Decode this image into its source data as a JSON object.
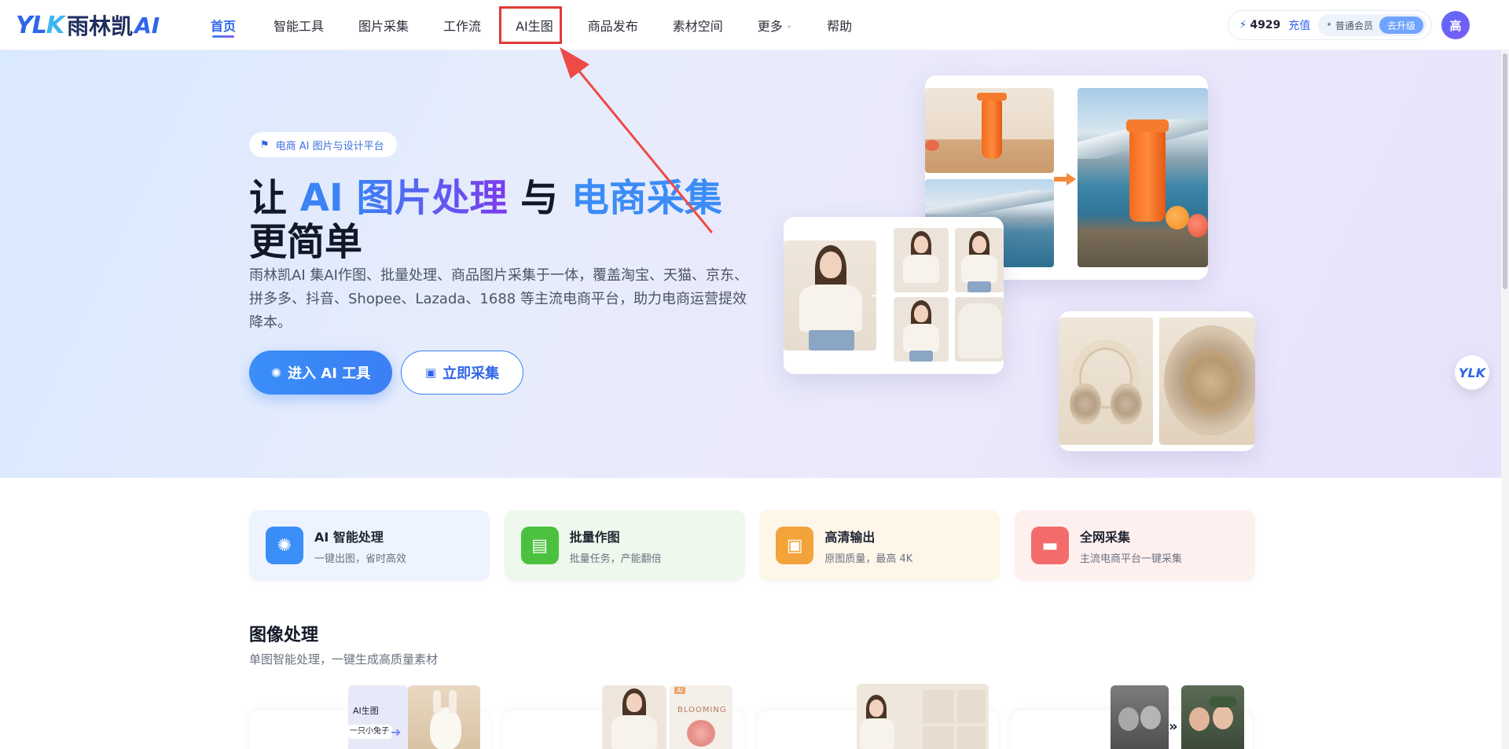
{
  "nav": {
    "logo_latin": "YLK",
    "logo_cn": "雨林凯",
    "logo_ai": "AI",
    "items": [
      {
        "label": "首页",
        "active": true
      },
      {
        "label": "智能工具"
      },
      {
        "label": "图片采集"
      },
      {
        "label": "工作流"
      },
      {
        "label": "AI生图",
        "highlighted": true
      },
      {
        "label": "商品发布"
      },
      {
        "label": "素材空间"
      },
      {
        "label": "更多",
        "has_dropdown": true
      },
      {
        "label": "帮助"
      }
    ],
    "credits": "4929",
    "recharge": "充值",
    "member": "普通会员",
    "upgrade": "去升级",
    "avatar": "高",
    "colors": {
      "accent": "#2f66e8",
      "highlight": "#e53935"
    }
  },
  "hero": {
    "badge": "电商 AI 图片与设计平台",
    "headline": {
      "p1": "让 ",
      "p2": "AI",
      "p3": " ",
      "p4": "图片处理",
      "p5": " 与 ",
      "p6": "电商采集",
      "p7": "更简单"
    },
    "description": "雨林凯AI 集AI作图、批量处理、商品图片采集于一体，覆盖淘宝、天猫、京东、拼多多、抖音、Shopee、Lazada、1688 等主流电商平台，助力电商运营提效降本。",
    "primary_button": "进入 AI 工具",
    "secondary_button": "立即采集"
  },
  "float_logo": "YLK",
  "features": [
    {
      "title": "AI 智能处理",
      "subtitle": "一键出图，省时高效",
      "icon": "sparkle-icon",
      "color": "#3b8df8",
      "bg": "#eef4ff"
    },
    {
      "title": "批量作图",
      "subtitle": "批量任务，产能翻倍",
      "icon": "layers-icon",
      "color": "#4cc13f",
      "bg": "#eef8ec"
    },
    {
      "title": "高清输出",
      "subtitle": "原图质量，最高 4K",
      "icon": "image-icon",
      "color": "#f2a33a",
      "bg": "#fff6ea"
    },
    {
      "title": "全网采集",
      "subtitle": "主流电商平台一键采集",
      "icon": "monitor-icon",
      "color": "#f36b6b",
      "bg": "#fff0f0"
    }
  ],
  "section": {
    "title": "图像处理",
    "subtitle": "单图智能处理，一键生成高质量素材"
  },
  "tool_thumbs": {
    "ai_label": "AI生图",
    "prompt": "一只小兔子",
    "tag_right": "BLOOMING"
  }
}
